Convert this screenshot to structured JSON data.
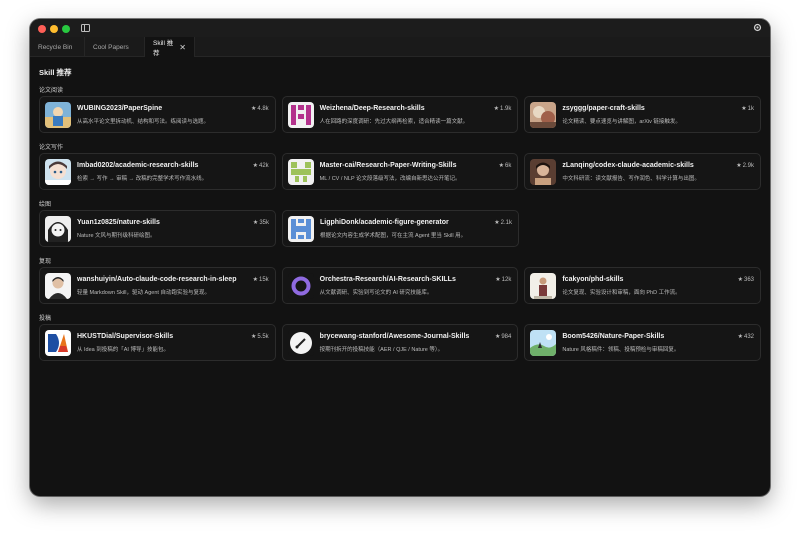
{
  "tabs": [
    {
      "label": "Recycle Bin"
    },
    {
      "label": "Cool Papers"
    },
    {
      "label": "Skill 推荐",
      "active": true
    }
  ],
  "page_title": "Skill 推荐",
  "sections": [
    {
      "label": "论文阅读",
      "cards": [
        {
          "name": "WUBING2023/PaperSpine",
          "desc": "从高水平论文里拆动机、结构和写法。练阅读与选题。",
          "stars": "4.8k",
          "avatar": "painting"
        },
        {
          "name": "Weizhena/Deep-Research-skills",
          "desc": "人在回路的深度调研：先过大纲再检索，适合精读一篇文献。",
          "stars": "1.9k",
          "avatar": "magenta-identicon"
        },
        {
          "name": "zsyggg/paper-craft-skills",
          "desc": "论文精读、要点速览与讲解图，arXiv 链接触发。",
          "stars": "1k",
          "avatar": "photo-food"
        }
      ]
    },
    {
      "label": "论文写作",
      "cards": [
        {
          "name": "Imbad0202/academic-research-skills",
          "desc": "检索 → 写作 → 审稿 → 改稿的完整学术写作流水线。",
          "stars": "42k",
          "avatar": "anime-girl"
        },
        {
          "name": "Master-cai/Research-Paper-Writing-Skills",
          "desc": "ML / CV / NLP 论文段落级写法，改编自新思达公开笔记。",
          "stars": "6k",
          "avatar": "green-identicon"
        },
        {
          "name": "zLanqing/codex-claude-academic-skills",
          "desc": "中文科研流：读文献报告、写作润色、科学计算与出图。",
          "stars": "2.9k",
          "avatar": "photo-person"
        }
      ]
    },
    {
      "label": "绘图",
      "cards": [
        {
          "name": "Yuan1z0825/nature-skills",
          "desc": "Nature 文风与期刊级科研绘图。",
          "stars": "35k",
          "avatar": "manga-face"
        },
        {
          "name": "LigphiDonk/academic-figure-generator",
          "desc": "根据论文内容生成学术配图，可在主流 Agent 里当 Skill 用。",
          "stars": "2.1k",
          "avatar": "blue-identicon"
        }
      ]
    },
    {
      "label": "复现",
      "cards": [
        {
          "name": "wanshuiyin/Auto-claude-code-research-in-sleep",
          "desc": "轻量 Markdown Skill，驱动 Agent 自动跑实验与复现。",
          "stars": "15k",
          "avatar": "photo-man"
        },
        {
          "name": "Orchestra-Research/AI-Research-SKILLs",
          "desc": "从文献调研、实验到写论文的 AI 研究技能库。",
          "stars": "12k",
          "avatar": "purple-ring"
        },
        {
          "name": "fcakyon/phd-skills",
          "desc": "论文复现、实验设计和审稿，面向 PhD 工作流。",
          "stars": "363",
          "avatar": "photo-figure"
        }
      ]
    },
    {
      "label": "投稿",
      "cards": [
        {
          "name": "HKUSTDial/Supervisor-Skills",
          "desc": "从 Idea 到投稿的「AI 博导」技能包。",
          "stars": "5.5k",
          "avatar": "logo-dial"
        },
        {
          "name": "brycewang-stanford/Awesome-Journal-Skills",
          "desc": "按期刊拆开的投稿技能（AER / QJE / Nature 等）。",
          "stars": "984",
          "avatar": "logo-bw"
        },
        {
          "name": "Boom5426/Nature-Paper-Skills",
          "desc": "Nature 风格稿件：领稿、投稿预检与审稿回复。",
          "stars": "432",
          "avatar": "landscape"
        }
      ]
    }
  ]
}
